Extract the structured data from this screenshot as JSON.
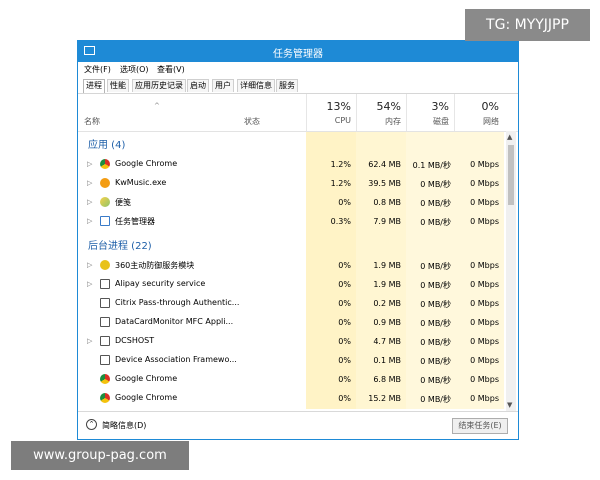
{
  "window": {
    "title": "任务管理器"
  },
  "menu": {
    "file": "文件(F)",
    "options": "选项(O)",
    "view": "查看(V)"
  },
  "tabs": [
    "进程",
    "性能",
    "应用历史记录",
    "启动",
    "用户",
    "详细信息",
    "服务"
  ],
  "header": {
    "sort_arrow": "^",
    "name_col": "名称",
    "status_col": "状态",
    "cpu": {
      "pct": "13%",
      "label": "CPU"
    },
    "mem": {
      "pct": "54%",
      "label": "内存"
    },
    "disk": {
      "pct": "3%",
      "label": "磁盘"
    },
    "net": {
      "pct": "0%",
      "label": "网络"
    }
  },
  "groups": {
    "apps": "应用 (4)",
    "background": "后台进程 (22)"
  },
  "rows": [
    {
      "name": "Google Chrome",
      "cpu": "1.2%",
      "mem": "62.4 MB",
      "disk": "0.1 MB/秒",
      "net": "0 Mbps"
    },
    {
      "name": "KwMusic.exe",
      "cpu": "1.2%",
      "mem": "39.5 MB",
      "disk": "0 MB/秒",
      "net": "0 Mbps"
    },
    {
      "name": "便笺",
      "cpu": "0%",
      "mem": "0.8 MB",
      "disk": "0 MB/秒",
      "net": "0 Mbps"
    },
    {
      "name": "任务管理器",
      "cpu": "0.3%",
      "mem": "7.9 MB",
      "disk": "0 MB/秒",
      "net": "0 Mbps"
    },
    {
      "name": "360主动防御服务模块",
      "cpu": "0%",
      "mem": "1.9 MB",
      "disk": "0 MB/秒",
      "net": "0 Mbps"
    },
    {
      "name": "Alipay security service",
      "cpu": "0%",
      "mem": "1.9 MB",
      "disk": "0 MB/秒",
      "net": "0 Mbps"
    },
    {
      "name": "Citrix Pass-through Authentic...",
      "cpu": "0%",
      "mem": "0.2 MB",
      "disk": "0 MB/秒",
      "net": "0 Mbps"
    },
    {
      "name": "DataCardMonitor MFC Appli...",
      "cpu": "0%",
      "mem": "0.9 MB",
      "disk": "0 MB/秒",
      "net": "0 Mbps"
    },
    {
      "name": "DCSHOST",
      "cpu": "0%",
      "mem": "4.7 MB",
      "disk": "0 MB/秒",
      "net": "0 Mbps"
    },
    {
      "name": "Device Association Framewo...",
      "cpu": "0%",
      "mem": "0.1 MB",
      "disk": "0 MB/秒",
      "net": "0 Mbps"
    },
    {
      "name": "Google Chrome",
      "cpu": "0%",
      "mem": "6.8 MB",
      "disk": "0 MB/秒",
      "net": "0 Mbps"
    },
    {
      "name": "Google Chrome",
      "cpu": "0%",
      "mem": "15.2 MB",
      "disk": "0 MB/秒",
      "net": "0 Mbps"
    }
  ],
  "footer": {
    "fewer_details": "简略信息(D)",
    "end_task": "结束任务(E)"
  },
  "overlays": {
    "tg": "TG: MYYJJPP",
    "url": "www.group-pag.com"
  },
  "colors": {
    "accent": "#1e8ad6",
    "heat": "#fff5cc",
    "group": "#1e5fa8"
  }
}
